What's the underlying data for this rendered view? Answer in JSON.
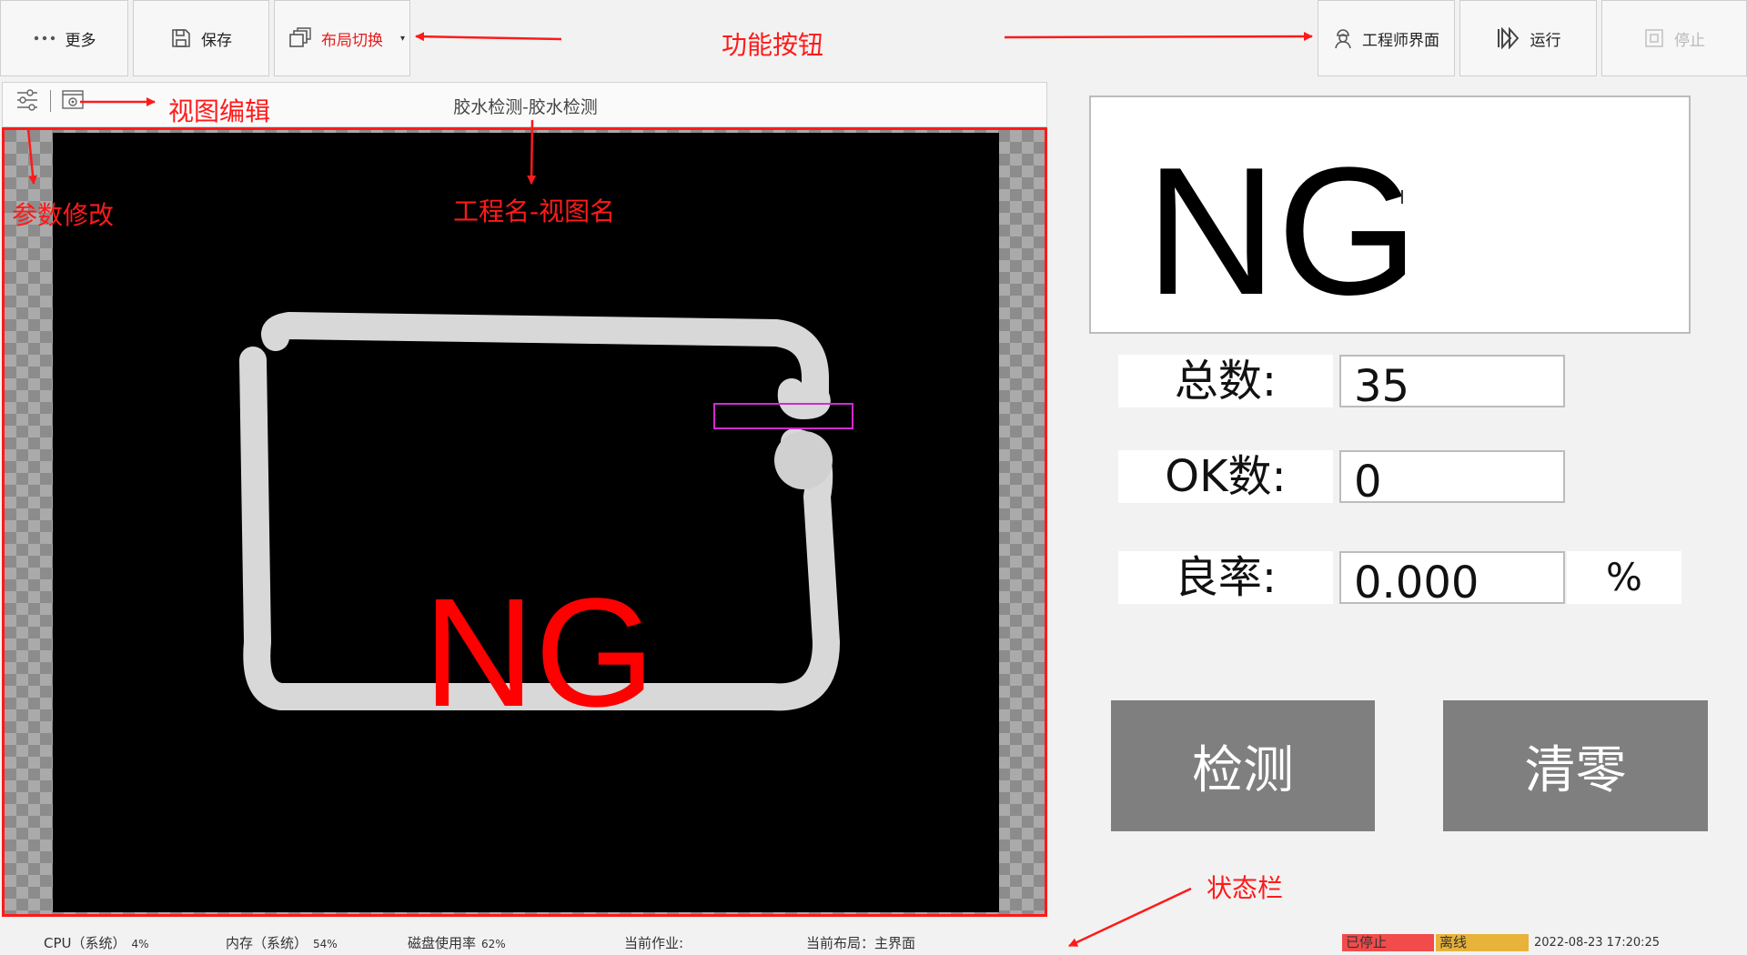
{
  "toolbar": {
    "more_label": "更多",
    "save_label": "保存",
    "layout_switch_label": "布局切换",
    "engineer_label": "工程师界面",
    "run_label": "运行",
    "stop_label": "停止"
  },
  "annotations": {
    "function_buttons": "功能按钮",
    "view_edit": "视图编辑",
    "param_modify": "参数修改",
    "project_view_name": "工程名-视图名",
    "status_bar": "状态栏"
  },
  "view": {
    "title": "胶水检测-胶水检测",
    "overlay_result": "NG"
  },
  "result": {
    "text": "NG",
    "cursor_glyph": "I"
  },
  "stats": {
    "total_label": "总数:",
    "total_value": "35",
    "ok_label": "OK数:",
    "ok_value": "0",
    "yield_label": "良率:",
    "yield_value": "0.000",
    "yield_unit": "%"
  },
  "actions": {
    "detect_label": "检测",
    "reset_label": "清零"
  },
  "status": {
    "cpu_label": "CPU（系统）",
    "cpu_value": "4%",
    "mem_label": "内存（系统）",
    "mem_value": "54%",
    "disk_label": "磁盘使用率",
    "disk_value": "62%",
    "job_label": "当前作业:",
    "layout_label": "当前布局：主界面",
    "run_state": "已停止",
    "conn_state": "离线",
    "datetime": "2022-08-23 17:20:25"
  },
  "colors": {
    "annotation": "#ff1a1a",
    "stopped_badge": "#f24b4b",
    "offline_badge": "#e8b33a",
    "action_button": "#7f7f7f",
    "roi_box": "#d22ad2"
  }
}
